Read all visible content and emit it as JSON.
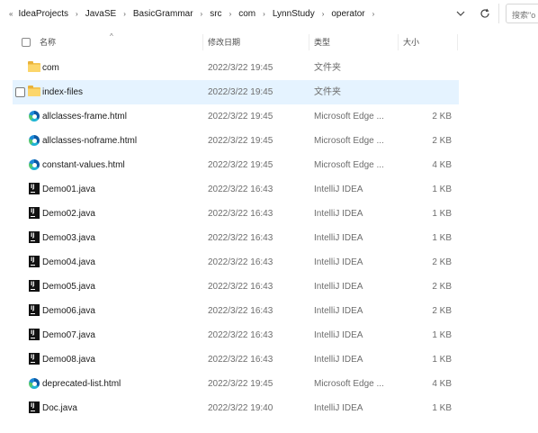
{
  "address_bar": {
    "leading": "«",
    "crumbs": [
      "IdeaProjects",
      "JavaSE",
      "BasicGrammar",
      "src",
      "com",
      "LynnStudy",
      "operator"
    ],
    "separator": "›",
    "search_placeholder": "搜索\"o"
  },
  "columns": {
    "name": "名称",
    "date": "修改日期",
    "type": "类型",
    "size": "大小",
    "sort_indicator": "^"
  },
  "files": [
    {
      "name": "com",
      "date": "2022/3/22 19:45",
      "type": "文件夹",
      "size": "",
      "icon": "folder-icon"
    },
    {
      "name": "index-files",
      "date": "2022/3/22 19:45",
      "type": "文件夹",
      "size": "",
      "icon": "folder-icon"
    },
    {
      "name": "allclasses-frame.html",
      "date": "2022/3/22 19:45",
      "type": "Microsoft Edge ...",
      "size": "2 KB",
      "icon": "edge-icon"
    },
    {
      "name": "allclasses-noframe.html",
      "date": "2022/3/22 19:45",
      "type": "Microsoft Edge ...",
      "size": "2 KB",
      "icon": "edge-icon"
    },
    {
      "name": "constant-values.html",
      "date": "2022/3/22 19:45",
      "type": "Microsoft Edge ...",
      "size": "4 KB",
      "icon": "edge-icon"
    },
    {
      "name": "Demo01.java",
      "date": "2022/3/22 16:43",
      "type": "IntelliJ IDEA",
      "size": "1 KB",
      "icon": "intellij-icon"
    },
    {
      "name": "Demo02.java",
      "date": "2022/3/22 16:43",
      "type": "IntelliJ IDEA",
      "size": "1 KB",
      "icon": "intellij-icon"
    },
    {
      "name": "Demo03.java",
      "date": "2022/3/22 16:43",
      "type": "IntelliJ IDEA",
      "size": "1 KB",
      "icon": "intellij-icon"
    },
    {
      "name": "Demo04.java",
      "date": "2022/3/22 16:43",
      "type": "IntelliJ IDEA",
      "size": "2 KB",
      "icon": "intellij-icon"
    },
    {
      "name": "Demo05.java",
      "date": "2022/3/22 16:43",
      "type": "IntelliJ IDEA",
      "size": "2 KB",
      "icon": "intellij-icon"
    },
    {
      "name": "Demo06.java",
      "date": "2022/3/22 16:43",
      "type": "IntelliJ IDEA",
      "size": "2 KB",
      "icon": "intellij-icon"
    },
    {
      "name": "Demo07.java",
      "date": "2022/3/22 16:43",
      "type": "IntelliJ IDEA",
      "size": "1 KB",
      "icon": "intellij-icon"
    },
    {
      "name": "Demo08.java",
      "date": "2022/3/22 16:43",
      "type": "IntelliJ IDEA",
      "size": "1 KB",
      "icon": "intellij-icon"
    },
    {
      "name": "deprecated-list.html",
      "date": "2022/3/22 19:45",
      "type": "Microsoft Edge ...",
      "size": "4 KB",
      "icon": "edge-icon"
    },
    {
      "name": "Doc.java",
      "date": "2022/3/22 19:40",
      "type": "IntelliJ IDEA",
      "size": "1 KB",
      "icon": "intellij-icon"
    }
  ],
  "hovered_row": 1,
  "colors": {
    "hover": "#e5f3ff",
    "folder": "#f4c552"
  }
}
